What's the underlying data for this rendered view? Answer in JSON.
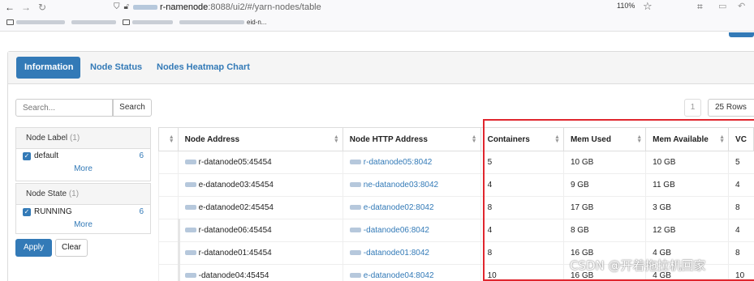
{
  "browser": {
    "back_icon": "←",
    "forward_icon": "→",
    "reload_icon": "↻",
    "url_prefix": "r-namenode",
    "url_rest": ":8088/ui2/#/yarn-nodes/table",
    "zoom": "110%",
    "star_icon": "☆",
    "bookmark_last": "eid-n..."
  },
  "tabs": [
    {
      "label": "Information"
    },
    {
      "label": "Node Status"
    },
    {
      "label": "Nodes Heatmap Chart"
    }
  ],
  "search": {
    "placeholder": "Search...",
    "button": "Search"
  },
  "pager": {
    "page": "1",
    "rows": "25 Rows"
  },
  "facets": {
    "node_label": {
      "title": "Node Label",
      "count": "(1)",
      "item": "default",
      "item_count": "6",
      "more": "More"
    },
    "node_state": {
      "title": "Node State",
      "count": "(1)",
      "item": "RUNNING",
      "item_count": "6",
      "more": "More"
    }
  },
  "buttons": {
    "apply": "Apply",
    "clear": "Clear"
  },
  "table": {
    "headers": [
      "Node Address",
      "Node HTTP Address",
      "Containers",
      "Mem Used",
      "Mem Available",
      "VC"
    ],
    "rows": [
      {
        "addr": "r-datanode05:45454",
        "http": "r-datanode05:8042",
        "containers": "5",
        "mem_used": "10 GB",
        "mem_avail": "10 GB",
        "vc": "5"
      },
      {
        "addr": "e-datanode03:45454",
        "http": "ne-datanode03:8042",
        "containers": "4",
        "mem_used": "9 GB",
        "mem_avail": "11 GB",
        "vc": "4"
      },
      {
        "addr": "e-datanode02:45454",
        "http": "e-datanode02:8042",
        "containers": "8",
        "mem_used": "17 GB",
        "mem_avail": "3 GB",
        "vc": "8"
      },
      {
        "addr": "r-datanode06:45454",
        "http": "-datanode06:8042",
        "containers": "4",
        "mem_used": "8 GB",
        "mem_avail": "12 GB",
        "vc": "4"
      },
      {
        "addr": "r-datanode01:45454",
        "http": "-datanode01:8042",
        "containers": "8",
        "mem_used": "16 GB",
        "mem_avail": "4 GB",
        "vc": "8"
      },
      {
        "addr": "-datanode04:45454",
        "http": "e-datanode04:8042",
        "containers": "10",
        "mem_used": "16 GB",
        "mem_avail": "4 GB",
        "vc": "10"
      }
    ]
  },
  "watermark_text": "CSDN @开着拖拉机回家",
  "colors": {
    "accent": "#337ab7",
    "highlight": "#e0262e"
  }
}
